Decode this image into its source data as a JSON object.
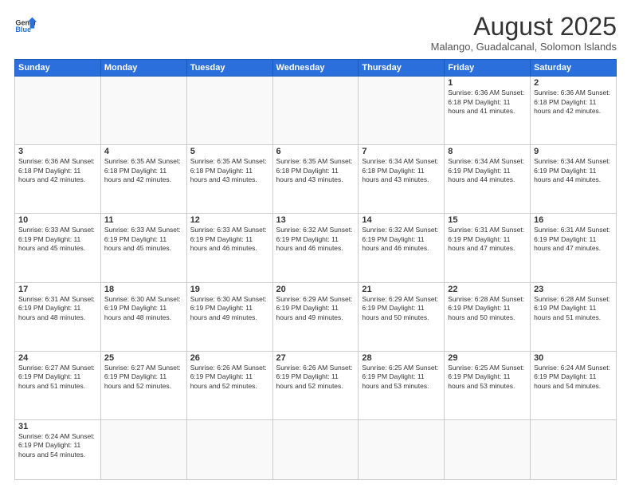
{
  "header": {
    "logo_general": "General",
    "logo_blue": "Blue",
    "month_year": "August 2025",
    "location": "Malango, Guadalcanal, Solomon Islands"
  },
  "weekdays": [
    "Sunday",
    "Monday",
    "Tuesday",
    "Wednesday",
    "Thursday",
    "Friday",
    "Saturday"
  ],
  "weeks": [
    [
      {
        "day": "",
        "info": ""
      },
      {
        "day": "",
        "info": ""
      },
      {
        "day": "",
        "info": ""
      },
      {
        "day": "",
        "info": ""
      },
      {
        "day": "",
        "info": ""
      },
      {
        "day": "1",
        "info": "Sunrise: 6:36 AM\nSunset: 6:18 PM\nDaylight: 11 hours\nand 41 minutes."
      },
      {
        "day": "2",
        "info": "Sunrise: 6:36 AM\nSunset: 6:18 PM\nDaylight: 11 hours\nand 42 minutes."
      }
    ],
    [
      {
        "day": "3",
        "info": "Sunrise: 6:36 AM\nSunset: 6:18 PM\nDaylight: 11 hours\nand 42 minutes."
      },
      {
        "day": "4",
        "info": "Sunrise: 6:35 AM\nSunset: 6:18 PM\nDaylight: 11 hours\nand 42 minutes."
      },
      {
        "day": "5",
        "info": "Sunrise: 6:35 AM\nSunset: 6:18 PM\nDaylight: 11 hours\nand 43 minutes."
      },
      {
        "day": "6",
        "info": "Sunrise: 6:35 AM\nSunset: 6:18 PM\nDaylight: 11 hours\nand 43 minutes."
      },
      {
        "day": "7",
        "info": "Sunrise: 6:34 AM\nSunset: 6:18 PM\nDaylight: 11 hours\nand 43 minutes."
      },
      {
        "day": "8",
        "info": "Sunrise: 6:34 AM\nSunset: 6:19 PM\nDaylight: 11 hours\nand 44 minutes."
      },
      {
        "day": "9",
        "info": "Sunrise: 6:34 AM\nSunset: 6:19 PM\nDaylight: 11 hours\nand 44 minutes."
      }
    ],
    [
      {
        "day": "10",
        "info": "Sunrise: 6:33 AM\nSunset: 6:19 PM\nDaylight: 11 hours\nand 45 minutes."
      },
      {
        "day": "11",
        "info": "Sunrise: 6:33 AM\nSunset: 6:19 PM\nDaylight: 11 hours\nand 45 minutes."
      },
      {
        "day": "12",
        "info": "Sunrise: 6:33 AM\nSunset: 6:19 PM\nDaylight: 11 hours\nand 46 minutes."
      },
      {
        "day": "13",
        "info": "Sunrise: 6:32 AM\nSunset: 6:19 PM\nDaylight: 11 hours\nand 46 minutes."
      },
      {
        "day": "14",
        "info": "Sunrise: 6:32 AM\nSunset: 6:19 PM\nDaylight: 11 hours\nand 46 minutes."
      },
      {
        "day": "15",
        "info": "Sunrise: 6:31 AM\nSunset: 6:19 PM\nDaylight: 11 hours\nand 47 minutes."
      },
      {
        "day": "16",
        "info": "Sunrise: 6:31 AM\nSunset: 6:19 PM\nDaylight: 11 hours\nand 47 minutes."
      }
    ],
    [
      {
        "day": "17",
        "info": "Sunrise: 6:31 AM\nSunset: 6:19 PM\nDaylight: 11 hours\nand 48 minutes."
      },
      {
        "day": "18",
        "info": "Sunrise: 6:30 AM\nSunset: 6:19 PM\nDaylight: 11 hours\nand 48 minutes."
      },
      {
        "day": "19",
        "info": "Sunrise: 6:30 AM\nSunset: 6:19 PM\nDaylight: 11 hours\nand 49 minutes."
      },
      {
        "day": "20",
        "info": "Sunrise: 6:29 AM\nSunset: 6:19 PM\nDaylight: 11 hours\nand 49 minutes."
      },
      {
        "day": "21",
        "info": "Sunrise: 6:29 AM\nSunset: 6:19 PM\nDaylight: 11 hours\nand 50 minutes."
      },
      {
        "day": "22",
        "info": "Sunrise: 6:28 AM\nSunset: 6:19 PM\nDaylight: 11 hours\nand 50 minutes."
      },
      {
        "day": "23",
        "info": "Sunrise: 6:28 AM\nSunset: 6:19 PM\nDaylight: 11 hours\nand 51 minutes."
      }
    ],
    [
      {
        "day": "24",
        "info": "Sunrise: 6:27 AM\nSunset: 6:19 PM\nDaylight: 11 hours\nand 51 minutes."
      },
      {
        "day": "25",
        "info": "Sunrise: 6:27 AM\nSunset: 6:19 PM\nDaylight: 11 hours\nand 52 minutes."
      },
      {
        "day": "26",
        "info": "Sunrise: 6:26 AM\nSunset: 6:19 PM\nDaylight: 11 hours\nand 52 minutes."
      },
      {
        "day": "27",
        "info": "Sunrise: 6:26 AM\nSunset: 6:19 PM\nDaylight: 11 hours\nand 52 minutes."
      },
      {
        "day": "28",
        "info": "Sunrise: 6:25 AM\nSunset: 6:19 PM\nDaylight: 11 hours\nand 53 minutes."
      },
      {
        "day": "29",
        "info": "Sunrise: 6:25 AM\nSunset: 6:19 PM\nDaylight: 11 hours\nand 53 minutes."
      },
      {
        "day": "30",
        "info": "Sunrise: 6:24 AM\nSunset: 6:19 PM\nDaylight: 11 hours\nand 54 minutes."
      }
    ],
    [
      {
        "day": "31",
        "info": "Sunrise: 6:24 AM\nSunset: 6:19 PM\nDaylight: 11 hours\nand 54 minutes."
      },
      {
        "day": "",
        "info": ""
      },
      {
        "day": "",
        "info": ""
      },
      {
        "day": "",
        "info": ""
      },
      {
        "day": "",
        "info": ""
      },
      {
        "day": "",
        "info": ""
      },
      {
        "day": "",
        "info": ""
      }
    ]
  ]
}
